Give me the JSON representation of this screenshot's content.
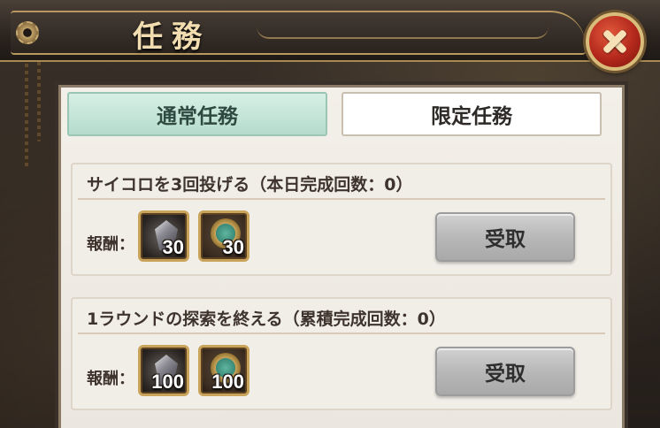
{
  "header": {
    "title": "任務"
  },
  "tabs": [
    {
      "label": "通常任務",
      "active": true
    },
    {
      "label": "限定任務",
      "active": false
    }
  ],
  "tasks": [
    {
      "title": "サイコロを3回投げる（本日完成回数：0）",
      "reward_label": "報酬：",
      "rewards": [
        {
          "icon": "crystal-icon",
          "count": "30"
        },
        {
          "icon": "medal-icon",
          "count": "30"
        }
      ],
      "button_label": "受取"
    },
    {
      "title": "1ラウンドの探索を終える（累積完成回数：0）",
      "reward_label": "報酬：",
      "rewards": [
        {
          "icon": "crystal-icon",
          "count": "100"
        },
        {
          "icon": "medal-icon",
          "count": "100"
        }
      ],
      "button_label": "受取"
    }
  ],
  "colors": {
    "active_tab": "#c2e4d6",
    "close_button": "#b3281c",
    "gold_trim": "#c9a35a"
  }
}
